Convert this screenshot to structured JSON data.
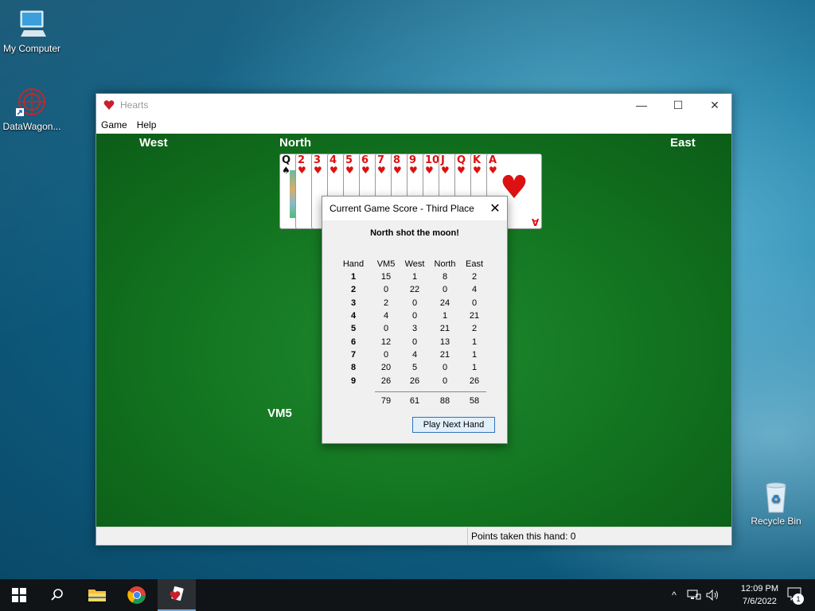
{
  "desktop": {
    "icons": [
      {
        "label": "My Computer"
      },
      {
        "label": "DataWagon..."
      },
      {
        "label": "Recycle Bin"
      }
    ]
  },
  "window": {
    "title": "Hearts",
    "menu": [
      "Game",
      "Help"
    ],
    "players": {
      "west": "West",
      "north": "North",
      "east": "East",
      "south": "VM5"
    },
    "north_hand": [
      {
        "rank": "Q",
        "suit": "♠",
        "color": "black"
      },
      {
        "rank": "2",
        "suit": "♥",
        "color": "red"
      },
      {
        "rank": "3",
        "suit": "♥",
        "color": "red"
      },
      {
        "rank": "4",
        "suit": "♥",
        "color": "red"
      },
      {
        "rank": "5",
        "suit": "♥",
        "color": "red"
      },
      {
        "rank": "6",
        "suit": "♥",
        "color": "red"
      },
      {
        "rank": "7",
        "suit": "♥",
        "color": "red"
      },
      {
        "rank": "8",
        "suit": "♥",
        "color": "red"
      },
      {
        "rank": "9",
        "suit": "♥",
        "color": "red"
      },
      {
        "rank": "10",
        "suit": "♥",
        "color": "red"
      },
      {
        "rank": "J",
        "suit": "♥",
        "color": "red"
      },
      {
        "rank": "Q",
        "suit": "♥",
        "color": "red"
      },
      {
        "rank": "K",
        "suit": "♥",
        "color": "red"
      },
      {
        "rank": "A",
        "suit": "♥",
        "color": "red"
      }
    ],
    "status": "Points taken this hand: 0"
  },
  "dialog": {
    "title": "Current Game Score - Third Place",
    "headline": "North shot the moon!",
    "columns": [
      "Hand",
      "VM5",
      "West",
      "North",
      "East"
    ],
    "rows": [
      [
        "1",
        "15",
        "1",
        "8",
        "2"
      ],
      [
        "2",
        "0",
        "22",
        "0",
        "4"
      ],
      [
        "3",
        "2",
        "0",
        "24",
        "0"
      ],
      [
        "4",
        "4",
        "0",
        "1",
        "21"
      ],
      [
        "5",
        "0",
        "3",
        "21",
        "2"
      ],
      [
        "6",
        "12",
        "0",
        "13",
        "1"
      ],
      [
        "7",
        "0",
        "4",
        "21",
        "1"
      ],
      [
        "8",
        "20",
        "5",
        "0",
        "1"
      ],
      [
        "9",
        "26",
        "26",
        "0",
        "26"
      ]
    ],
    "totals": [
      "79",
      "61",
      "88",
      "58"
    ],
    "button": "Play Next Hand"
  },
  "taskbar": {
    "time": "12:09 PM",
    "date": "7/6/2022",
    "notifications": "1"
  }
}
